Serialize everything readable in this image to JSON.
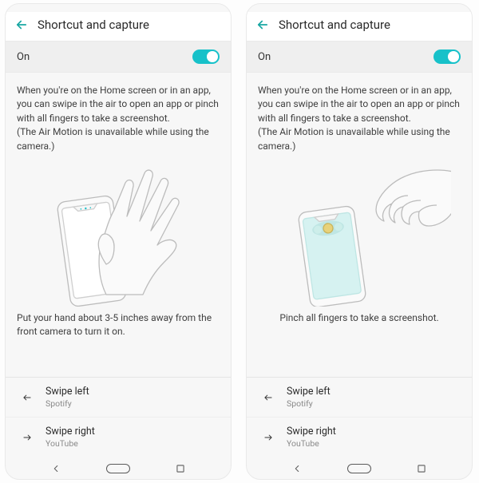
{
  "left": {
    "appbar_title": "Shortcut and capture",
    "toggle_label": "On",
    "description_line1": "When you're on the Home screen or in an app, you can swipe in the air to open an app or pinch with all fingers to take a screenshot.",
    "description_line2": "(The Air Motion is unavailable while using the camera.)",
    "caption": "Put your hand about 3-5 inches away from the front camera to turn it on.",
    "actions": [
      {
        "label": "Swipe left",
        "sub": "Spotify"
      },
      {
        "label": "Swipe right",
        "sub": "YouTube"
      }
    ]
  },
  "right": {
    "appbar_title": "Shortcut and capture",
    "toggle_label": "On",
    "description_line1": "When you're on the Home screen or in an app, you can swipe in the air to open an app or pinch with all fingers to take a screenshot.",
    "description_line2": "(The Air Motion is unavailable while using the camera.)",
    "caption": "Pinch all fingers to take a screenshot.",
    "actions": [
      {
        "label": "Swipe left",
        "sub": "Spotify"
      },
      {
        "label": "Swipe right",
        "sub": "YouTube"
      }
    ]
  }
}
